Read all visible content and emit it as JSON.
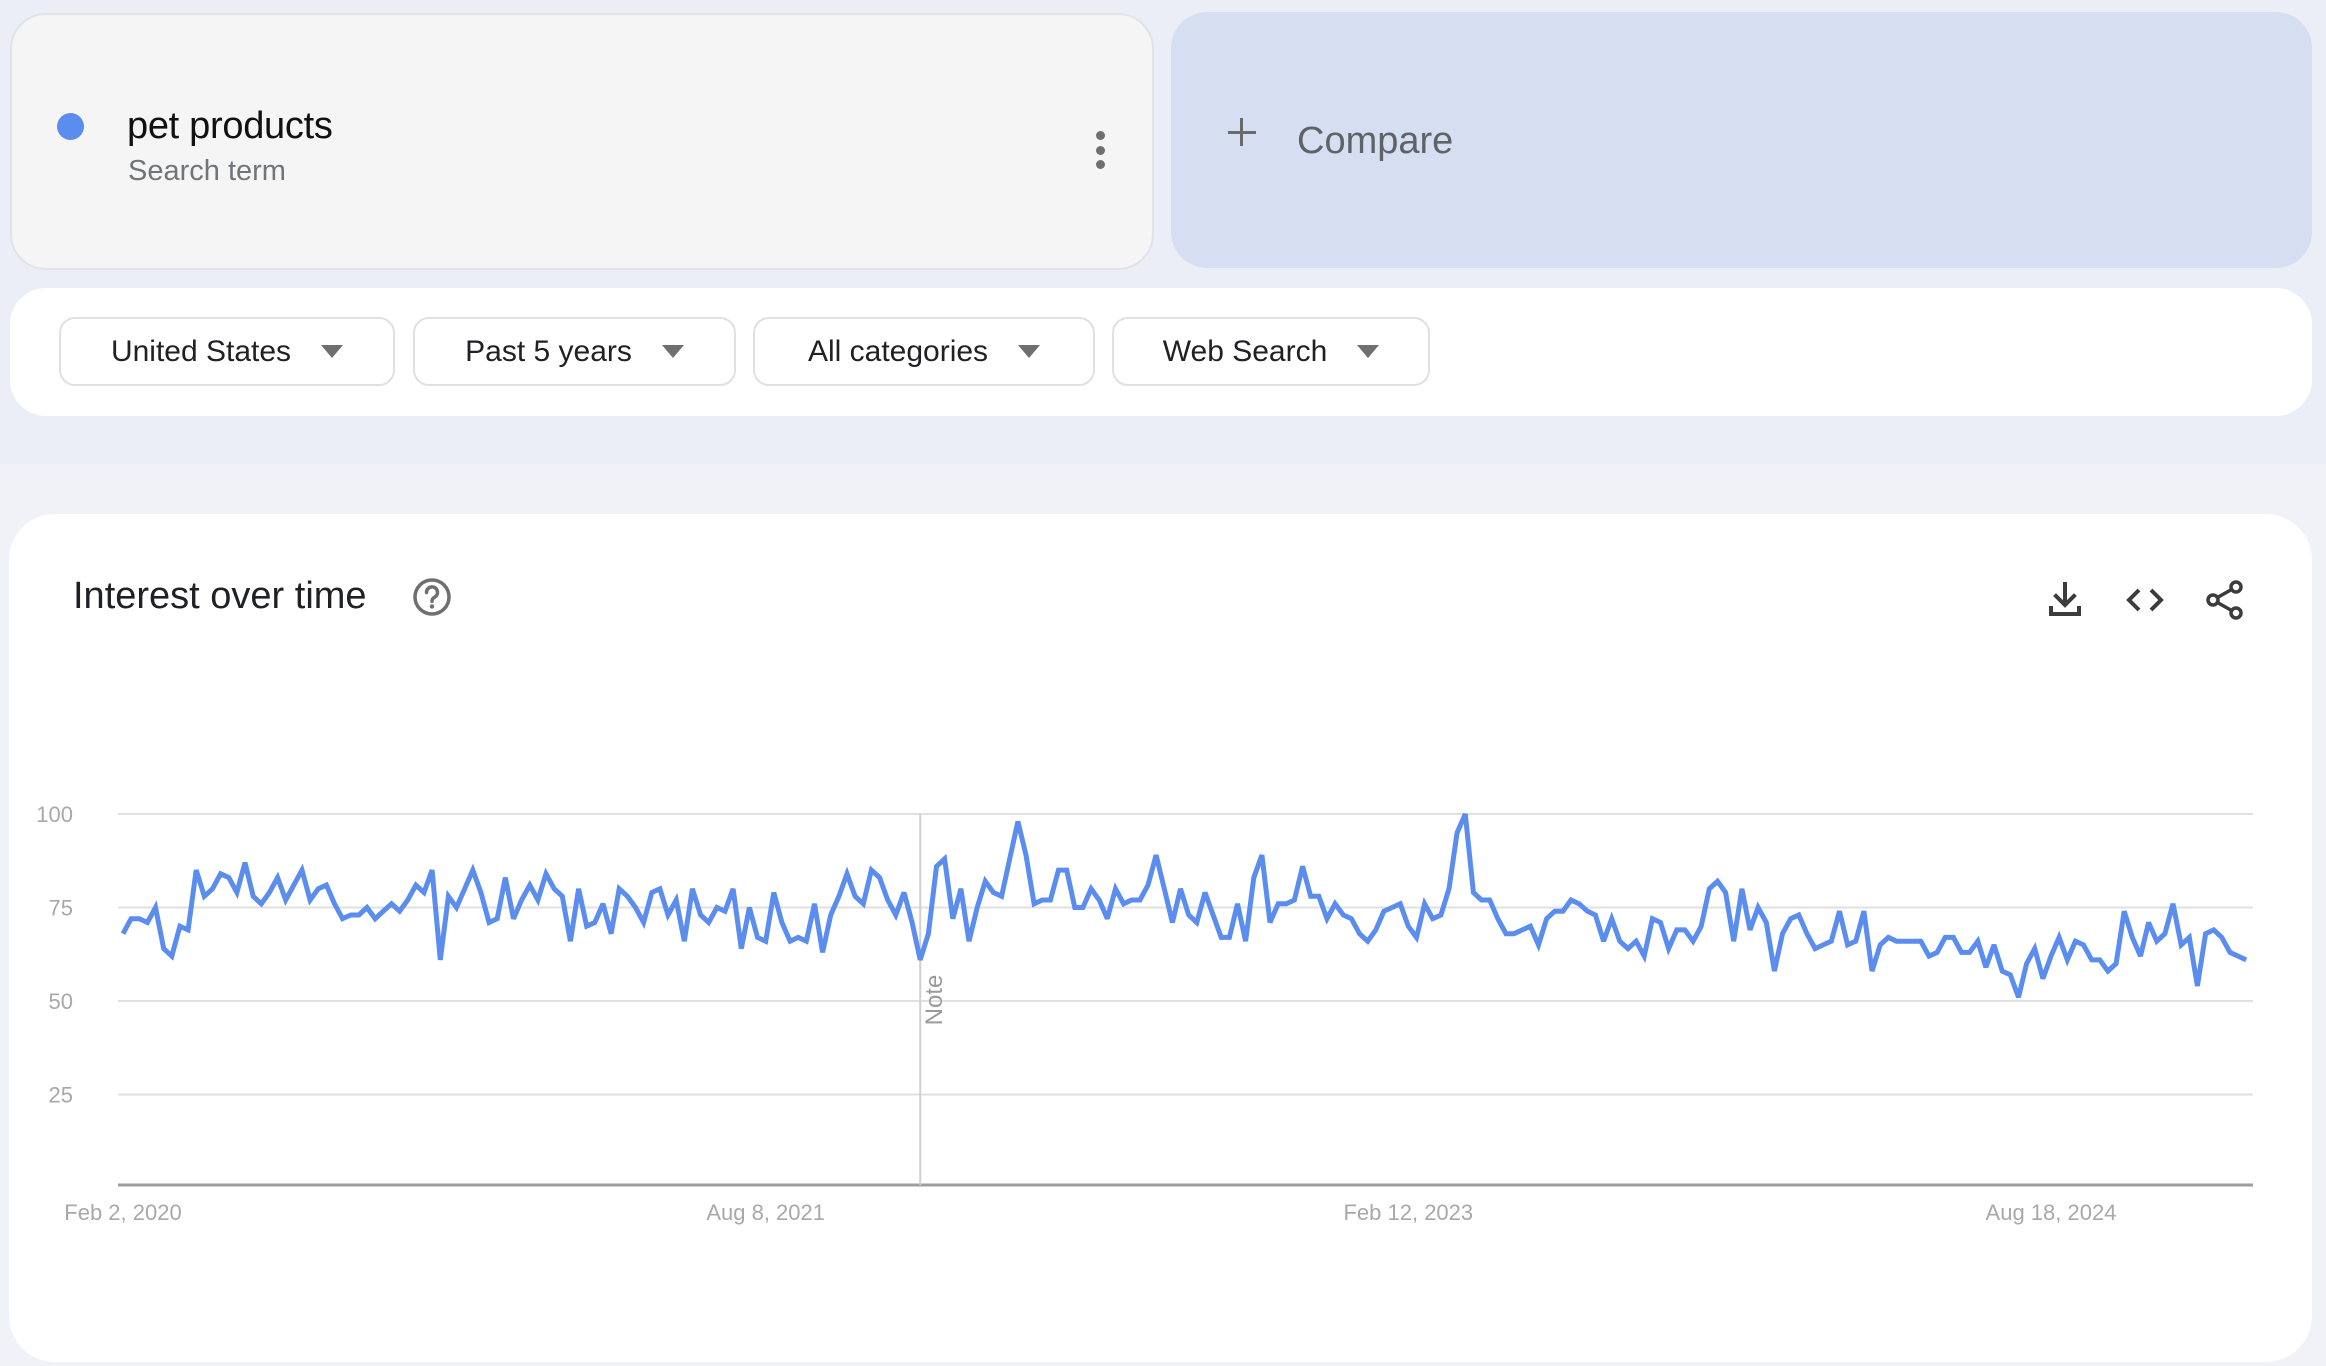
{
  "term": {
    "name": "pet products",
    "subtitle": "Search term",
    "color": "#5b8def",
    "menu_icon": "more-vert-icon"
  },
  "compare": {
    "label": "Compare",
    "icon": "plus-icon"
  },
  "filters": [
    {
      "label": "United States",
      "icon": "caret-down-icon"
    },
    {
      "label": "Past 5 years",
      "icon": "caret-down-icon"
    },
    {
      "label": "All categories",
      "icon": "caret-down-icon"
    },
    {
      "label": "Web Search",
      "icon": "caret-down-icon"
    }
  ],
  "chart_card": {
    "title": "Interest over time",
    "help_icon": "help-circle-icon",
    "tools": [
      "download-icon",
      "embed-code-icon",
      "share-icon"
    ]
  },
  "chart_data": {
    "type": "line",
    "title": "Interest over time",
    "xlabel": "",
    "ylabel": "",
    "ylim": [
      0,
      100
    ],
    "yticks": [
      25,
      50,
      75,
      100
    ],
    "xtick_labels": [
      "Feb 2, 2020",
      "Aug 8, 2021",
      "Feb 12, 2023",
      "Aug 18, 2024"
    ],
    "xtick_week_index": [
      0,
      79,
      158,
      237
    ],
    "grid": true,
    "annotations": [
      {
        "label": "Note",
        "week_index": 98
      }
    ],
    "series": [
      {
        "name": "pet products",
        "color": "#5b8def",
        "start": "Feb 2, 2020",
        "interval": "weekly",
        "values": [
          68,
          72,
          72,
          71,
          75,
          64,
          62,
          70,
          69,
          85,
          78,
          80,
          84,
          83,
          79,
          87,
          78,
          76,
          79,
          83,
          77,
          81,
          85,
          77,
          80,
          81,
          76,
          72,
          73,
          73,
          75,
          72,
          74,
          76,
          74,
          77,
          81,
          79,
          85,
          61,
          78,
          75,
          80,
          85,
          79,
          71,
          72,
          83,
          72,
          77,
          81,
          77,
          84,
          80,
          78,
          66,
          80,
          70,
          71,
          76,
          68,
          80,
          78,
          75,
          71,
          79,
          80,
          73,
          77,
          66,
          80,
          73,
          71,
          75,
          74,
          80,
          64,
          75,
          67,
          66,
          79,
          71,
          66,
          67,
          66,
          76,
          63,
          73,
          78,
          84,
          78,
          76,
          85,
          83,
          77,
          73,
          79,
          71,
          61,
          68,
          86,
          88,
          72,
          80,
          66,
          75,
          82,
          79,
          78,
          88,
          98,
          89,
          76,
          77,
          77,
          85,
          85,
          75,
          75,
          80,
          77,
          72,
          80,
          76,
          77,
          77,
          81,
          89,
          80,
          71,
          80,
          73,
          71,
          79,
          73,
          67,
          67,
          76,
          66,
          83,
          89,
          71,
          76,
          76,
          77,
          86,
          78,
          78,
          72,
          76,
          73,
          72,
          68,
          66,
          69,
          74,
          75,
          76,
          70,
          67,
          76,
          72,
          73,
          80,
          95,
          100,
          79,
          77,
          77,
          72,
          68,
          68,
          69,
          70,
          65,
          72,
          74,
          74,
          77,
          76,
          74,
          73,
          66,
          72,
          66,
          64,
          66,
          62,
          72,
          71,
          64,
          69,
          69,
          66,
          70,
          80,
          82,
          79,
          66,
          80,
          69,
          75,
          71,
          58,
          68,
          72,
          73,
          68,
          64,
          65,
          66,
          74,
          65,
          66,
          74,
          58,
          65,
          67,
          66,
          66,
          66,
          66,
          62,
          63,
          67,
          67,
          63,
          63,
          66,
          59,
          65,
          58,
          57,
          51,
          60,
          64,
          56,
          62,
          67,
          61,
          66,
          65,
          61,
          61,
          58,
          60,
          74,
          67,
          62,
          71,
          66,
          68,
          76,
          65,
          67,
          54,
          68,
          69,
          67,
          63,
          62,
          61
        ]
      }
    ]
  }
}
